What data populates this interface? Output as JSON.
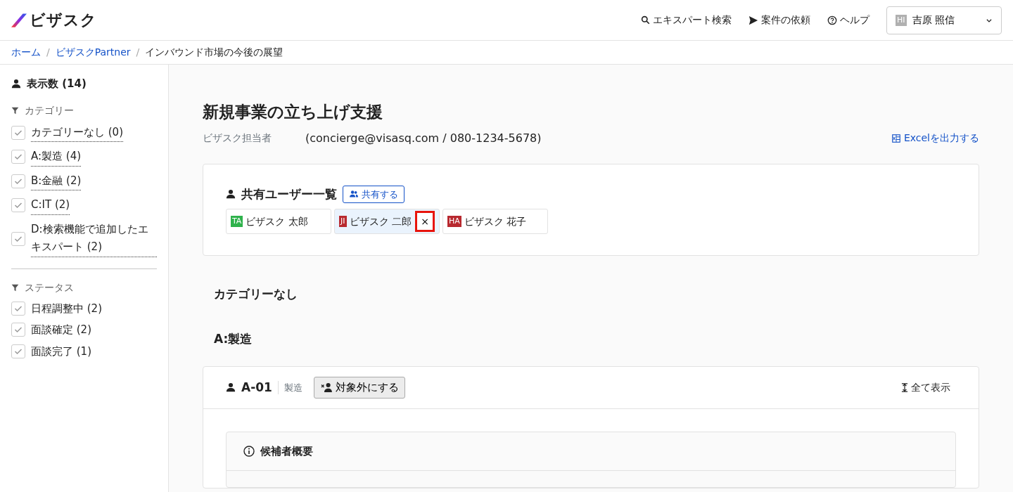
{
  "header": {
    "logo": "ビザスク",
    "nav": [
      {
        "kind": "search",
        "label": "エキスパート検索"
      },
      {
        "kind": "send",
        "label": "案件の依頼"
      },
      {
        "kind": "help",
        "label": "ヘルプ"
      }
    ],
    "user": {
      "initials": "HI",
      "color": "#b0b0b0",
      "name": "吉原 照信"
    }
  },
  "breadcrumb_separator": "/",
  "breadcrumb": [
    {
      "label": "ホーム",
      "link": true
    },
    {
      "label": "ビザスクPartner",
      "link": true
    },
    {
      "label": "インバウンド市場の今後の展望",
      "link": false
    }
  ],
  "sidebar": {
    "count_label": "表示数 (14)",
    "groups": [
      {
        "title": "カテゴリー",
        "items": [
          {
            "label": "カテゴリーなし (0)",
            "checked": true,
            "dotted": true
          },
          {
            "label": "A:製造 (4)",
            "checked": true,
            "dotted": true
          },
          {
            "label": "B:金融 (2)",
            "checked": true,
            "dotted": true
          },
          {
            "label": "C:IT (2)",
            "checked": true,
            "dotted": true
          },
          {
            "label": "D:検索機能で追加したエキスパート (2)",
            "checked": true,
            "dotted": true
          }
        ]
      },
      {
        "title": "ステータス",
        "items": [
          {
            "label": "日程調整中 (2)",
            "checked": true,
            "dotted": false
          },
          {
            "label": "面談確定 (2)",
            "checked": true,
            "dotted": false
          },
          {
            "label": "面談完了 (1)",
            "checked": true,
            "dotted": false
          }
        ]
      }
    ]
  },
  "main": {
    "title": "新規事業の立ち上げ支援",
    "contact_label": "ビザスク担当者",
    "contact": "(concierge@visasq.com / 080-1234-5678)",
    "export_link": "Excelを出力する",
    "share": {
      "title": "共有ユーザー一覧",
      "button": "共有する",
      "users": [
        {
          "initials": "TA",
          "color": "#2fb24c",
          "name": "ビザスク 太郎",
          "selected": false
        },
        {
          "initials": "JI",
          "color": "#b8292f",
          "name": "ビザスク 二郎",
          "selected": true,
          "remove": "×"
        },
        {
          "initials": "HA",
          "color": "#b8292f",
          "name": "ビザスク 花子",
          "selected": false
        }
      ]
    },
    "sections": [
      "カテゴリーなし",
      "A:製造"
    ],
    "expert": {
      "id": "A-01",
      "category": "製造",
      "exclude_button": "対象外にする",
      "show_all": "全て表示",
      "panel_title": "候補者概要"
    }
  }
}
